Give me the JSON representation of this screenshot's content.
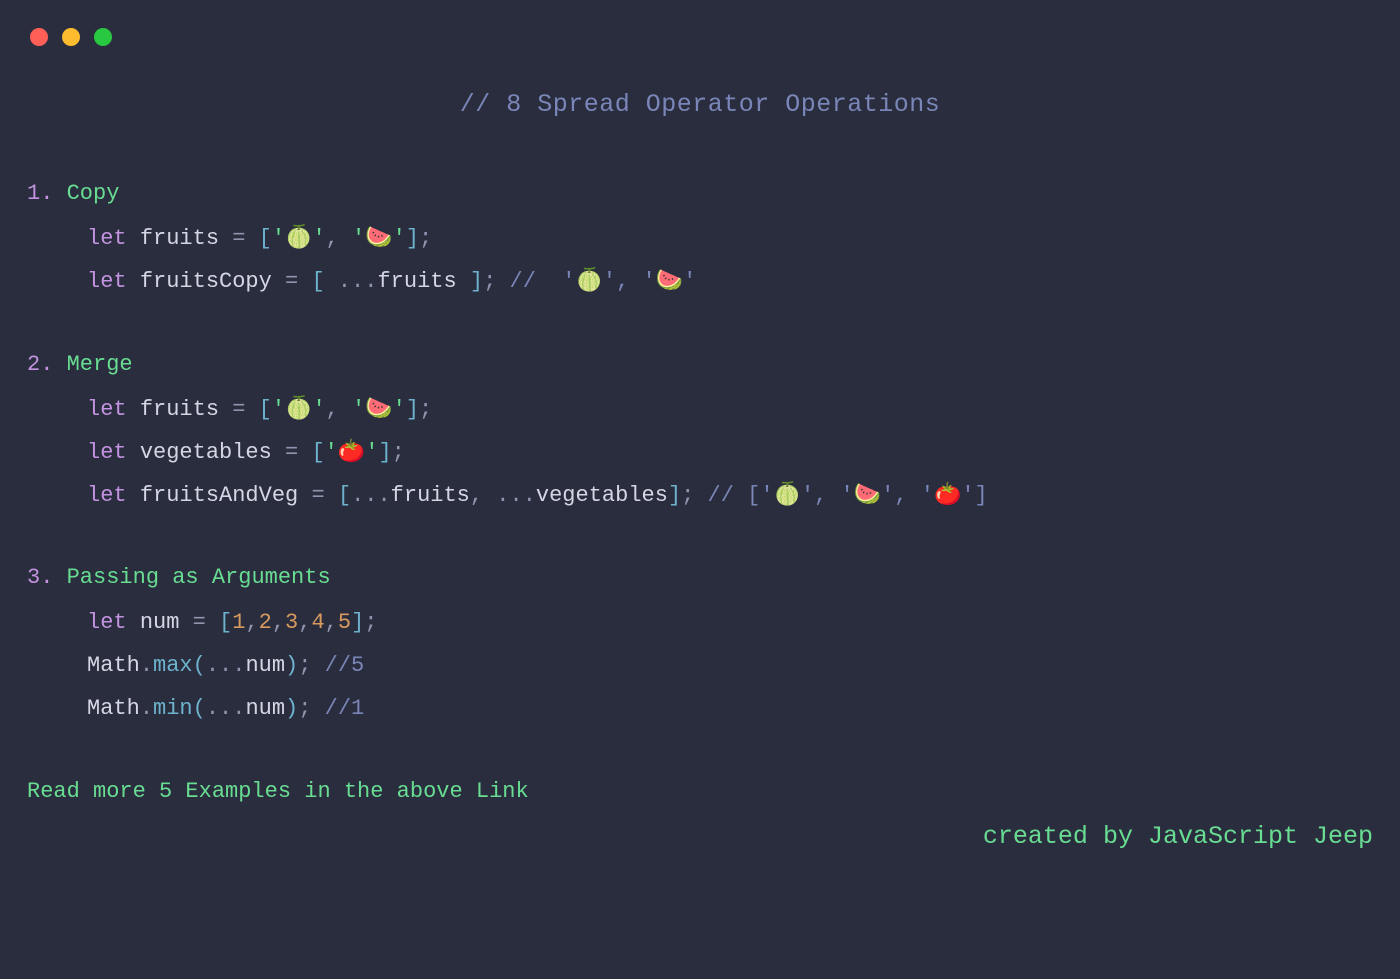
{
  "title_comment": "// 8 Spread Operator Operations",
  "sections": [
    {
      "num": "1.",
      "title": "Copy",
      "l0": {
        "kw": "let",
        "id": "fruits",
        "eq": "=",
        "open": "[",
        "v0": "'🍈'",
        "c0": ",",
        "v1": "'🍉'",
        "close": "]",
        "semi": ";"
      },
      "l1": {
        "kw": "let",
        "id": "fruitsCopy",
        "eq": "=",
        "open": "[ ",
        "spread": "...",
        "ref": "fruits",
        "close": " ]",
        "semi": ";",
        "comment": " //  '🍈', '🍉'"
      }
    },
    {
      "num": "2.",
      "title": "Merge",
      "l0": {
        "kw": "let",
        "id": "fruits",
        "eq": "=",
        "open": "[",
        "v0": "'🍈'",
        "c0": ",",
        "v1": "'🍉'",
        "close": "]",
        "semi": ";"
      },
      "l1": {
        "kw": "let",
        "id": "vegetables",
        "eq": "=",
        "open": "[",
        "v0": "'🍅'",
        "close": "]",
        "semi": ";"
      },
      "l2": {
        "kw": "let",
        "id": "fruitsAndVeg",
        "eq": "=",
        "open": "[",
        "s0": "...",
        "r0": "fruits",
        "c0": ",",
        "s1": "...",
        "r1": "vegetables",
        "close": "]",
        "semi": ";",
        "comment": " // ['🍈', '🍉', '🍅']"
      }
    },
    {
      "num": "3.",
      "title": "Passing as Arguments",
      "l0": {
        "kw": "let",
        "id": "num",
        "eq": "=",
        "open": "[",
        "n0": "1",
        "c0": ",",
        "n1": "2",
        "c1": ",",
        "n2": "3",
        "c2": ",",
        "n3": "4",
        "c3": ",",
        "n4": "5",
        "close": "]",
        "semi": ";"
      },
      "l1": {
        "obj": "Math",
        "dot": ".",
        "fn": "max",
        "po": "(",
        "spread": "...",
        "ref": "num",
        "pc": ")",
        "semi": ";",
        "comment": " //5"
      },
      "l2": {
        "obj": "Math",
        "dot": ".",
        "fn": "min",
        "po": "(",
        "spread": "...",
        "ref": "num",
        "pc": ")",
        "semi": ";",
        "comment": " //1"
      }
    }
  ],
  "read_more": "Read more 5 Examples in the above Link",
  "credit": "created by JavaScript Jeep"
}
